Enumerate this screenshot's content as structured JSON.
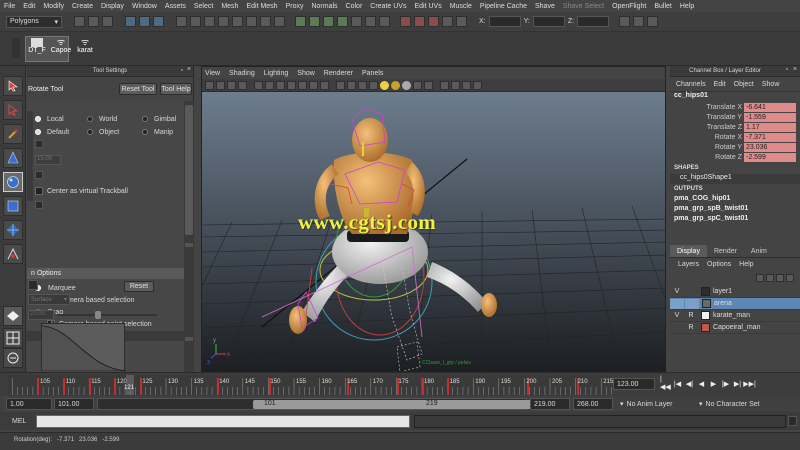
{
  "menus": [
    "File",
    "Edit",
    "Modify",
    "Create",
    "Display",
    "Window",
    "Assets",
    "Select",
    "Mesh",
    "Edit Mesh",
    "Proxy",
    "Normals",
    "Color",
    "Create UVs",
    "Edit UVs",
    "Muscle",
    "Pipeline Cache",
    "Shave",
    "Shave Select",
    "OpenFlight",
    "Bullet",
    "Help"
  ],
  "status_line": {
    "mode": "Polygons",
    "x_label": "X:",
    "y_label": "Y:",
    "z_label": "Z:"
  },
  "shelf": {
    "items": [
      {
        "label": "DT_F",
        "icon": "shelf-icon"
      },
      {
        "label": "Capoe",
        "icon": "shelf-icon"
      },
      {
        "label": "karat",
        "icon": "shelf-icon"
      }
    ]
  },
  "tool_settings": {
    "panel_title": "Tool Settings",
    "tool_name": "Rotate Tool",
    "reset_tool": "Reset Tool",
    "tool_help": "Tool Help",
    "axis_orientation": [
      {
        "label": "Local",
        "checked": true
      },
      {
        "label": "World",
        "checked": false
      },
      {
        "label": "Gimbal",
        "checked": false
      },
      {
        "label": "Default",
        "checked": true
      },
      {
        "label": "Object",
        "checked": false
      },
      {
        "label": "Manip",
        "checked": false
      }
    ],
    "step_value": "15.00",
    "virtual_trackball": "Center as virtual Trackball",
    "section_options": "n Options",
    "marquee": "Marquee",
    "camera_based_selection": "Camera based selection",
    "drag": "Drag",
    "camera_based_paint": "Camera based paint selection",
    "reset": "Reset",
    "surface_dropdown": "Surface",
    "falloff_value": "20.00"
  },
  "viewport": {
    "menus": [
      "View",
      "Shading",
      "Lighting",
      "Show",
      "Renderer",
      "Panels"
    ],
    "watermark": "www.cgtsj.com",
    "axis_x": "x",
    "axis_y": "y",
    "axis_z": "z",
    "bottom_label": "CCbase_l_grp / pelvis",
    "background_top": "#6d7d8e",
    "background_bottom": "#1c1e22"
  },
  "channel_box": {
    "title": "Channel Box / Layer Editor",
    "menus": [
      "Channels",
      "Edit",
      "Object",
      "Show"
    ],
    "object_name": "cc_hips01",
    "channels": [
      {
        "label": "Translate X",
        "value": "-6.641"
      },
      {
        "label": "Translate Y",
        "value": "-1.559"
      },
      {
        "label": "Translate Z",
        "value": "1.17"
      },
      {
        "label": "Rotate X",
        "value": "-7.371"
      },
      {
        "label": "Rotate Y",
        "value": "23.036"
      },
      {
        "label": "Rotate Z",
        "value": "-2.599"
      }
    ],
    "shapes_header": "SHAPES",
    "shape_name": "cc_hips0Shape1",
    "outputs_header": "OUTPUTS",
    "outputs": [
      "pma_COG_hip01",
      "pma_grp_spB_twist01",
      "pma_grp_spC_twist01"
    ],
    "accent_color": "#e08a8a"
  },
  "layer_editor": {
    "tabs": [
      "Display",
      "Render",
      "Anim"
    ],
    "menus": [
      "Layers",
      "Options",
      "Help"
    ],
    "layers": [
      {
        "v": "V",
        "p": "",
        "name": "layer1",
        "color": "#2e2e2e",
        "selected": false
      },
      {
        "v": "",
        "p": "",
        "name": "arena",
        "color": "#6a6a6a",
        "selected": true
      },
      {
        "v": "V",
        "p": "R",
        "name": "karate_man",
        "color": "#f2f2f2",
        "selected": false
      },
      {
        "v": "",
        "p": "R",
        "name": "Capoeiral_man",
        "color": "#c0574a",
        "selected": false
      }
    ]
  },
  "timeline": {
    "ticks": [
      "105",
      "110",
      "115",
      "120",
      "125",
      "130",
      "135",
      "140",
      "145",
      "150",
      "155",
      "160",
      "165",
      "170",
      "175",
      "180",
      "185",
      "190",
      "195",
      "200",
      "205",
      "210",
      "215"
    ],
    "current_frame_marker": "121",
    "current_frame": "123.00"
  },
  "range_slider": {
    "start": "1.00",
    "anim_start": "101.00",
    "range_start": "101",
    "range_end": "219",
    "anim_end": "219.00",
    "end": "268.00",
    "anim_layer": "No Anim Layer",
    "character_set": "No Character Set"
  },
  "command_line": {
    "label": "MEL"
  },
  "help_line": {
    "text": "Rotation(deg):   -7.371   23.036   -2.599"
  }
}
